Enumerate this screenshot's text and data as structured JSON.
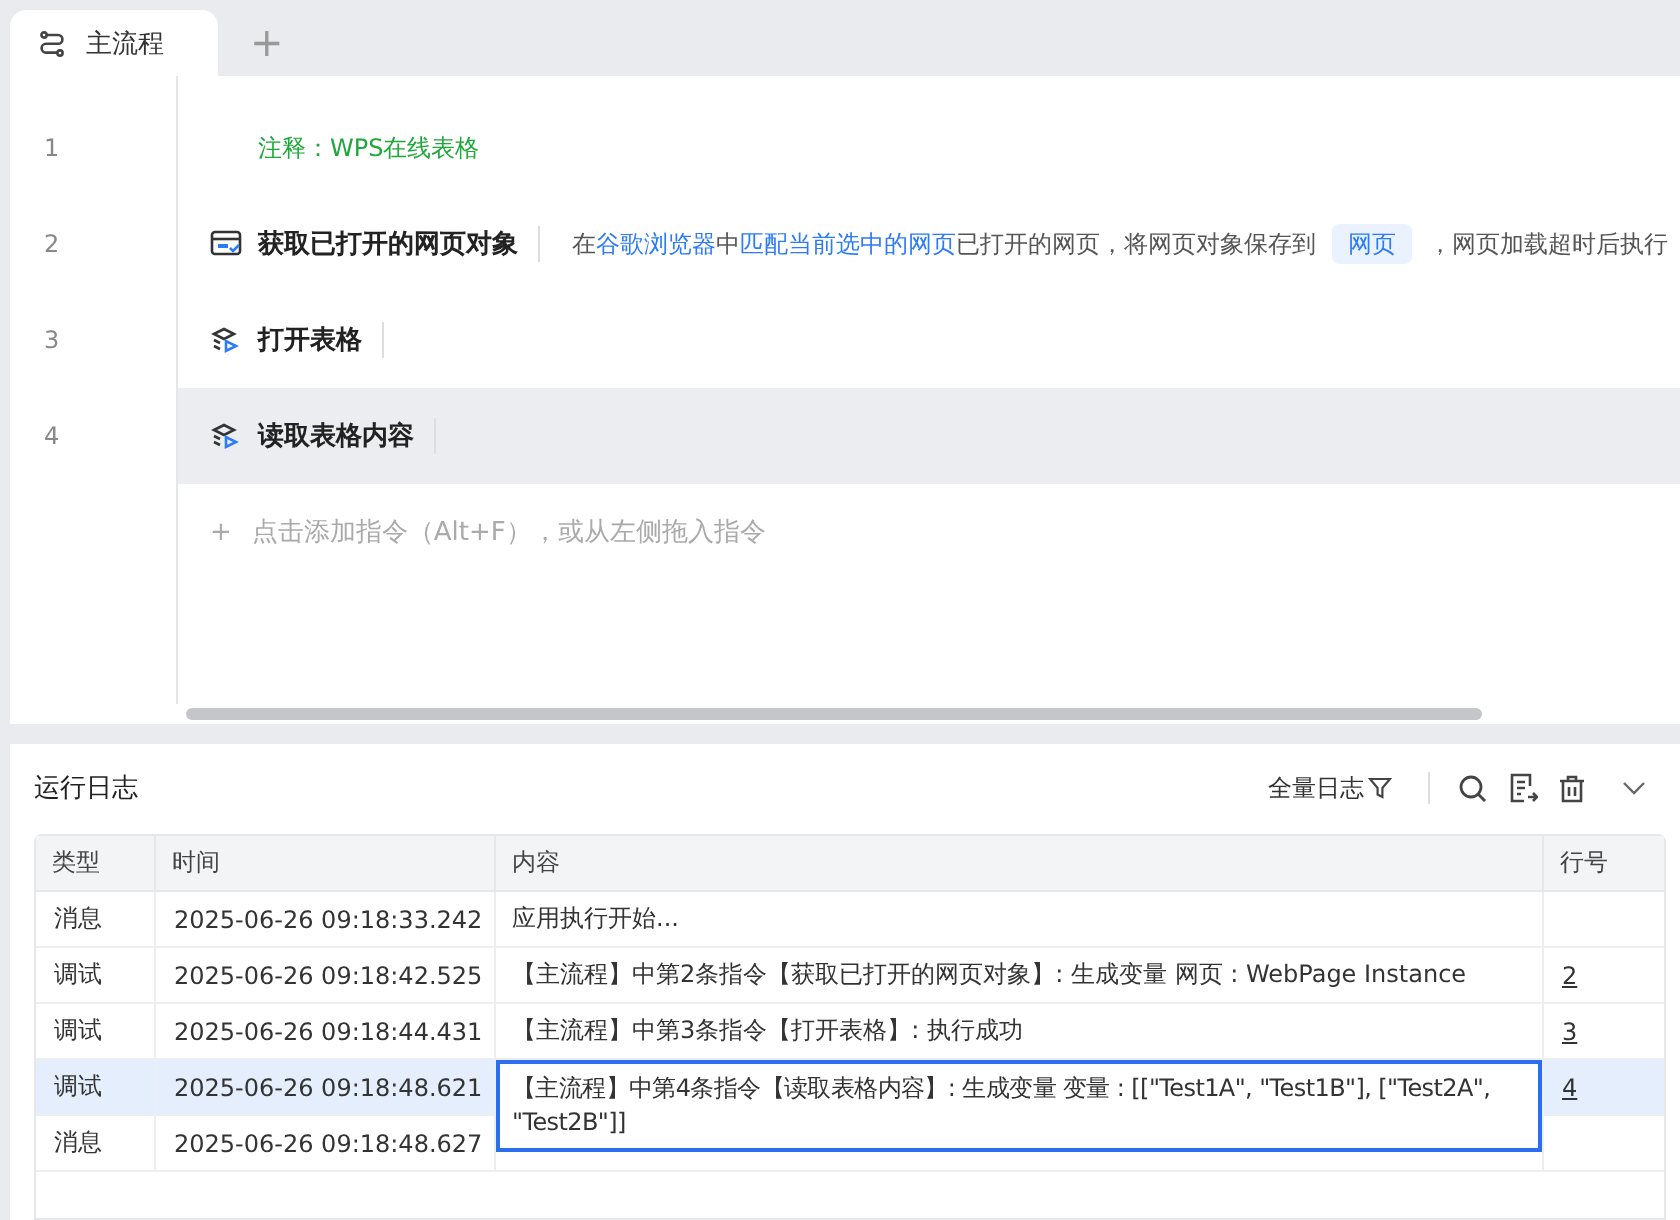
{
  "tabs": [
    {
      "label": "主流程",
      "selected": true
    }
  ],
  "add_tab": "+",
  "steps": [
    {
      "number": "1",
      "kind": "comment",
      "title": "注释：WPS在线表格",
      "selected": false
    },
    {
      "number": "2",
      "kind": "browser",
      "title": "获取已打开的网页对象",
      "selected": false,
      "description": [
        {
          "kind": "text",
          "text": "在"
        },
        {
          "kind": "link",
          "text": "谷歌浏览器"
        },
        {
          "kind": "text",
          "text": "中"
        },
        {
          "kind": "link",
          "text": "匹配当前选中的网页"
        },
        {
          "kind": "text",
          "text": "已打开的网页，将网页对象保存到"
        },
        {
          "kind": "chip",
          "text": "网页"
        },
        {
          "kind": "text",
          "text": "，网页加载超时后执行"
        }
      ]
    },
    {
      "number": "3",
      "kind": "sheet",
      "title": "打开表格",
      "selected": false
    },
    {
      "number": "4",
      "kind": "sheet",
      "title": "读取表格内容",
      "selected": true
    }
  ],
  "add_step": {
    "plus": "+",
    "hint": "点击添加指令（Alt+F），或从左侧拖入指令"
  },
  "log": {
    "title": "运行日志",
    "filter": "全量日志",
    "columns": [
      "类型",
      "时间",
      "内容",
      "行号"
    ],
    "rows": [
      {
        "type": "消息",
        "time": "2025-06-26 09:18:33.242",
        "content": "应用执行开始...",
        "line": "",
        "selected": false,
        "expanded": false
      },
      {
        "type": "调试",
        "time": "2025-06-26 09:18:42.525",
        "content": "【主流程】中第2条指令【获取已打开的网页对象】: 生成变量 网页 : WebPage Instance",
        "line": "2",
        "selected": false,
        "expanded": false
      },
      {
        "type": "调试",
        "time": "2025-06-26 09:18:44.431",
        "content": "【主流程】中第3条指令【打开表格】: 执行成功",
        "line": "3",
        "selected": false,
        "expanded": false
      },
      {
        "type": "调试",
        "time": "2025-06-26 09:18:48.621",
        "content": "【主流程】中第4条指令【读取表格内容】: 生成变量 变量 : [[\"Test1A\", \"Test1B\"], [\"Test2A\", \"Test2B\"]]",
        "line": "4",
        "selected": true,
        "expanded": true
      },
      {
        "type": "消息",
        "time": "2025-06-26 09:18:48.627",
        "content": "",
        "line": "",
        "selected": false,
        "expanded": false
      }
    ]
  }
}
